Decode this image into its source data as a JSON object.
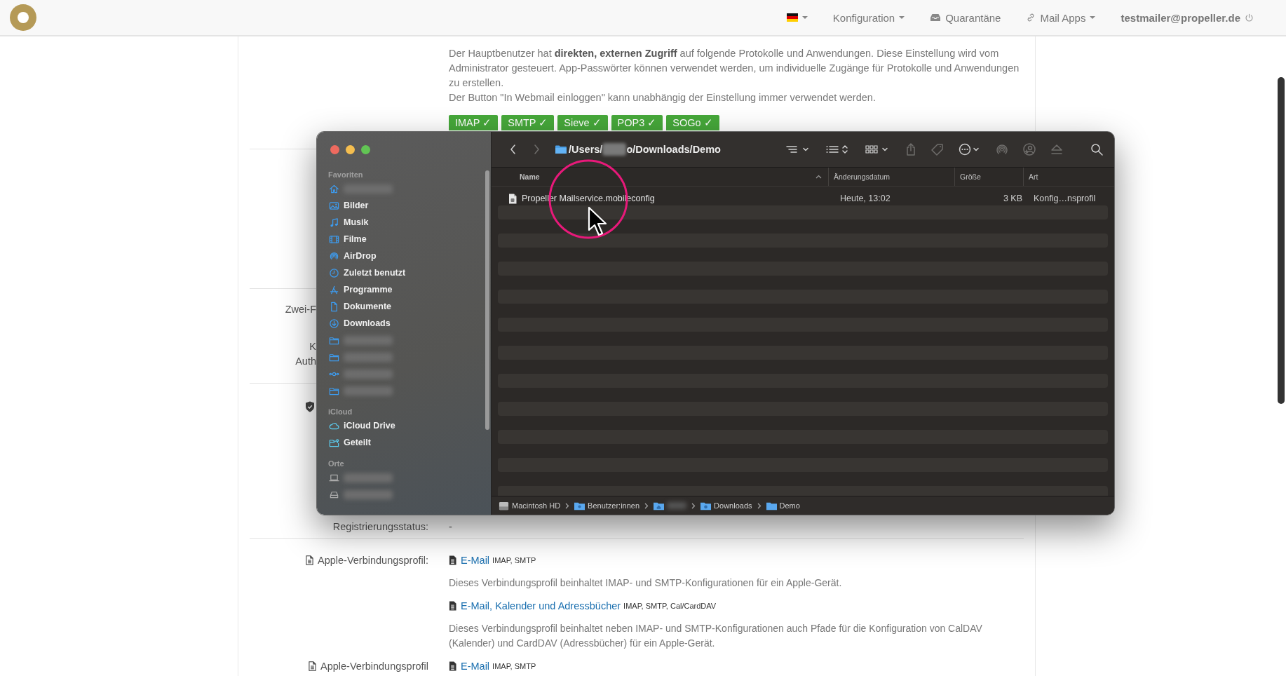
{
  "topbar": {
    "nav": [
      {
        "kind": "flag",
        "dropdown": true
      },
      {
        "kind": "plain",
        "label": "Konfiguration",
        "dropdown": true
      },
      {
        "kind": "quarantine",
        "label": "Quarantäne",
        "dropdown": false
      },
      {
        "kind": "link",
        "label": "Mail Apps",
        "dropdown": true
      }
    ],
    "user": {
      "email": "testmailer@propeller.de"
    }
  },
  "access": {
    "description": [
      "Der Hauptbenutzer hat **direkten, externen Zugriff** auf folgende Protokolle und Anwendungen. Diese Einstellung wird vom Administrator gesteuert. App-Passwörter können verwendet werden, um individuelle Zugänge für Protokolle und Anwendungen zu erstellen.",
      "Der Button \"In Webmail einloggen\" kann unabhängig der Einstellung immer verwendet werden."
    ],
    "protocols": [
      {
        "label": "IMAP ✓"
      },
      {
        "label": "SMTP ✓"
      },
      {
        "label": "Sieve ✓"
      },
      {
        "label": "POP3 ✓"
      },
      {
        "label": "SOGo ✓"
      }
    ]
  },
  "covered_labels": [
    [
      "Zwei-F"
    ],
    [
      "K",
      "Auth"
    ]
  ],
  "registration": {
    "label": "Registrierungsstatus:",
    "value": "-"
  },
  "profiles": [
    {
      "label": "Apple-Verbindungsprofil:",
      "links": [
        {
          "text": "E-Mail",
          "protocols": "IMAP, SMTP",
          "description": "Dieses Verbindungsprofil beinhaltet IMAP- und SMTP-Konfigurationen für ein Apple-Gerät."
        },
        {
          "text": "E-Mail, Kalender und Adressbücher",
          "protocols": "IMAP, SMTP, Cal/CardDAV",
          "description": "Dieses Verbindungsprofil beinhaltet neben IMAP- und SMTP-Konfigurationen auch Pfade für die Konfiguration von CalDAV (Kalender) und CardDAV (Adressbücher) für ein Apple-Gerät."
        }
      ]
    },
    {
      "label": "Apple-Verbindungsprofil",
      "links": [
        {
          "text": "E-Mail",
          "protocols": "IMAP, SMTP"
        }
      ]
    }
  ],
  "finder": {
    "title_parts": [
      {
        "kind": "text",
        "text": "/Users/"
      },
      {
        "kind": "blurred"
      },
      {
        "kind": "text",
        "text": "o/Downloads/Demo"
      }
    ],
    "sidebar": [
      {
        "heading": "Favoriten",
        "items": [
          {
            "kind": "home"
          },
          {
            "kind": "picture",
            "label": "Bilder"
          },
          {
            "kind": "music",
            "label": "Musik"
          },
          {
            "kind": "film",
            "label": "Filme"
          },
          {
            "kind": "airdrop",
            "label": "AirDrop"
          },
          {
            "kind": "clock",
            "label": "Zuletzt benutzt"
          },
          {
            "kind": "apps",
            "label": "Programme"
          },
          {
            "kind": "document",
            "label": "Dokumente"
          },
          {
            "kind": "download",
            "label": "Downloads"
          },
          {
            "kind": "folder"
          },
          {
            "kind": "folder"
          },
          {
            "kind": "network"
          },
          {
            "kind": "folder"
          }
        ]
      },
      {
        "heading": "iCloud",
        "items": [
          {
            "kind": "cloud",
            "label": "iCloud Drive"
          },
          {
            "kind": "shared",
            "label": "Geteilt"
          }
        ]
      },
      {
        "heading": "Orte",
        "items": [
          {
            "kind": "laptop"
          },
          {
            "kind": "drive"
          }
        ]
      }
    ],
    "columns": [
      {
        "label": "Name",
        "sorted": true
      },
      {
        "label": "Änderungsdatum",
        "sorted": false
      },
      {
        "label": "Größe",
        "sorted": false
      },
      {
        "label": "Art",
        "sorted": false
      }
    ],
    "files": [
      {
        "name": "Propeller Mailservice.mobileconfig",
        "modified": "Heute, 13:02",
        "size": "3 KB",
        "type": "Konfig…nsprofil"
      }
    ],
    "path_bar": [
      {
        "kind": "disk",
        "label": "Macintosh HD"
      },
      {
        "kind": "users",
        "label": "Benutzer:innen"
      },
      {
        "kind": "home-folder"
      },
      {
        "kind": "download-folder",
        "label": "Downloads"
      },
      {
        "kind": "folder",
        "label": "Demo"
      }
    ]
  }
}
